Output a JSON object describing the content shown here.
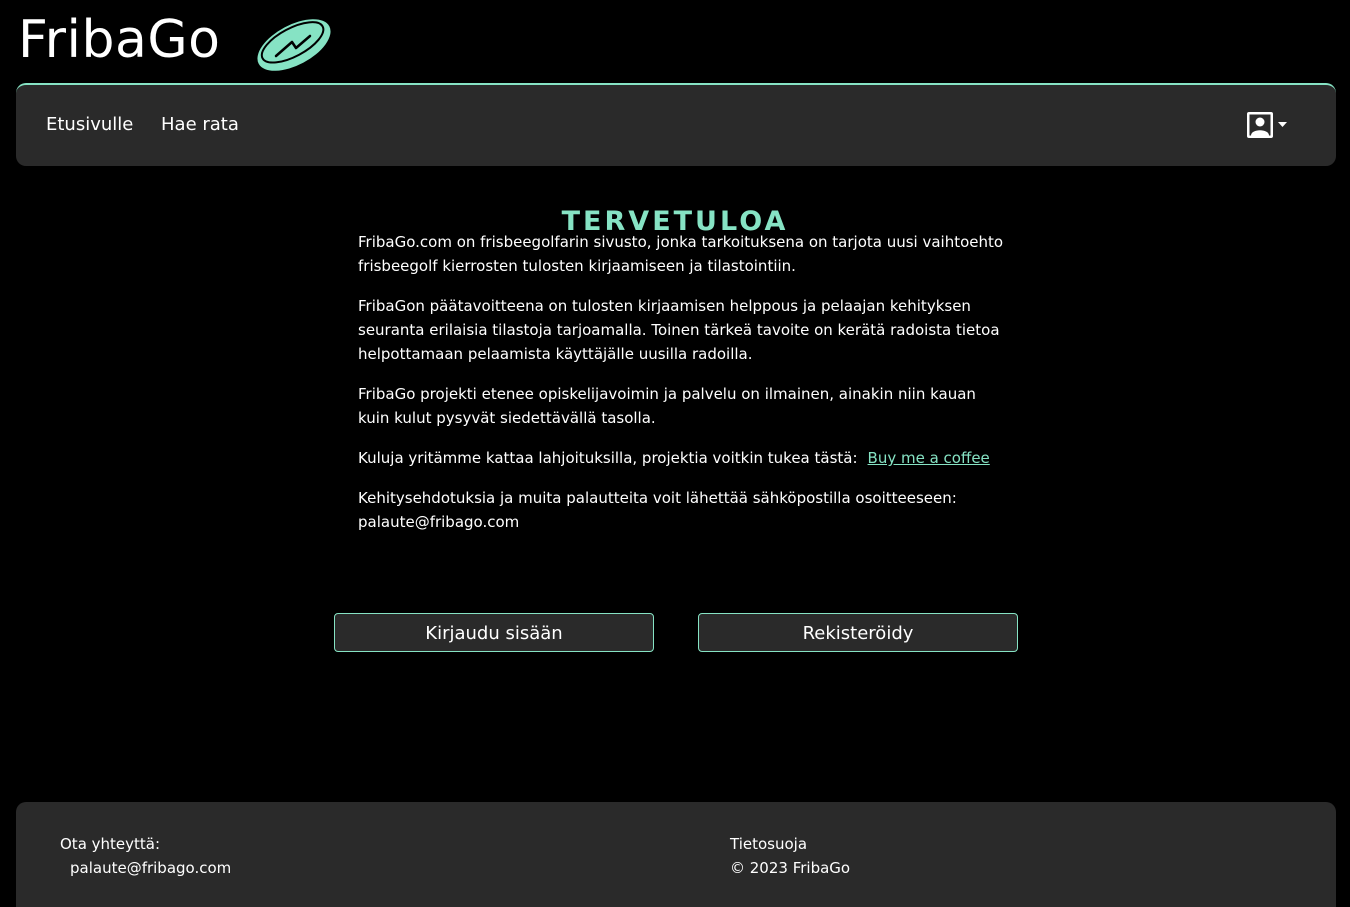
{
  "brand": {
    "name": "FribaGo",
    "logo_icon": "frisbee-disc-icon",
    "accent_color": "#86e3c4"
  },
  "nav": {
    "home_label": "Etusivulle",
    "search_label": "Hae rata",
    "user_icon": "user-profile-icon"
  },
  "main": {
    "title": "TERVETULOA",
    "paragraph_1": "FribaGo.com on frisbeegolfarin sivusto, jonka tarkoituksena on tarjota uusi vaihtoehto frisbeegolf kierrosten tulosten kirjaamiseen ja tilastointiin.",
    "paragraph_2": "FribaGon päätavoitteena on tulosten kirjaamisen helppous ja pelaajan kehityksen seuranta erilaisia tilastoja tarjoamalla. Toinen tärkeä tavoite on kerätä radoista tietoa helpottamaan pelaamista käyttäjälle uusilla radoilla.",
    "paragraph_3": "FribaGo projekti etenee opiskelijavoimin ja palvelu on ilmainen, ainakin niin kauan kuin kulut pysyvät siedettävällä tasolla.",
    "donation_text": "Kuluja yritämme kattaa lahjoituksilla, projektia voitkin tukea tästä:",
    "donation_link": "Buy me a coffee",
    "feedback_text": "Kehitysehdotuksia ja muita palautteita voit lähettää sähköpostilla osoitteeseen:",
    "feedback_email": "palaute@fribago.com"
  },
  "buttons": {
    "login_label": "Kirjaudu sisään",
    "register_label": "Rekisteröidy"
  },
  "footer": {
    "contact_heading": "Ota yhteyttä:",
    "contact_email": "palaute@fribago.com",
    "privacy_label": "Tietosuoja",
    "copyright": "© 2023 FribaGo"
  }
}
